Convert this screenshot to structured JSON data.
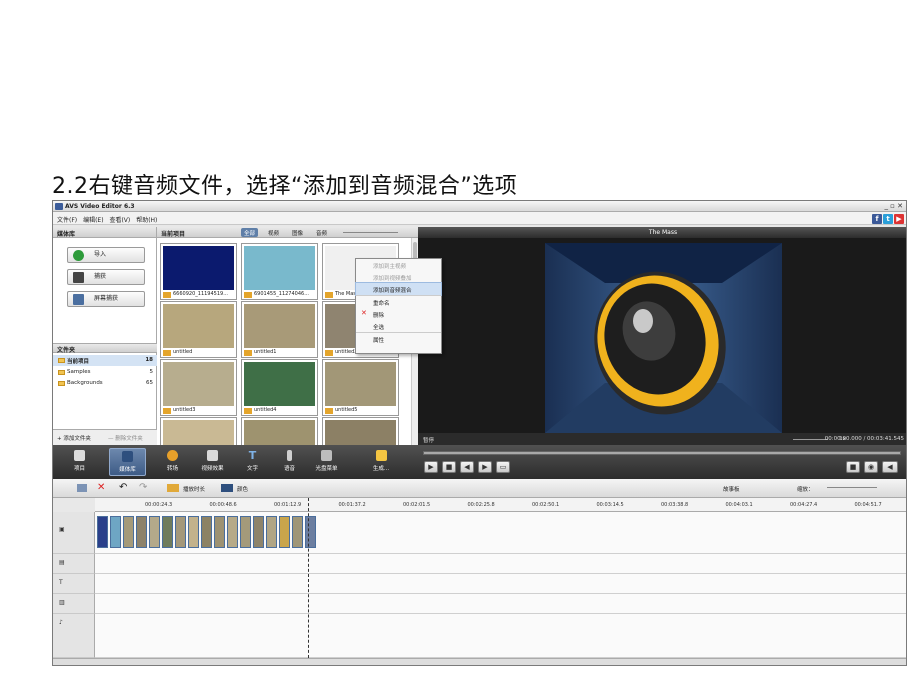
{
  "heading": "2.2右键音频文件，选择“添加到音频混合”选项",
  "window": {
    "title": "AVS Video Editor 6.3",
    "controls": "_ ▫ ✕"
  },
  "menu": [
    "文件(F)",
    "编辑(E)",
    "查看(V)",
    "帮助(H)"
  ],
  "social": [
    {
      "icon": "facebook-icon",
      "label": "f",
      "color": "#3b5998"
    },
    {
      "icon": "twitter-icon",
      "label": "t",
      "color": "#2b9fd9"
    },
    {
      "icon": "youtube-icon",
      "label": "▶",
      "color": "#d33"
    }
  ],
  "library": {
    "title": "媒体库",
    "buttons": [
      "导入",
      "捕获",
      "屏幕捕获"
    ],
    "folders_title": "文件夹",
    "folders": [
      {
        "name": "当前项目",
        "count": "18"
      },
      {
        "name": "Samples",
        "count": "5"
      },
      {
        "name": "Backgrounds",
        "count": "65"
      }
    ],
    "add_folder": "+ 添加文件夹",
    "remove_folder": "— 删除文件夹"
  },
  "media": {
    "current": "当前项目",
    "filters": [
      "全部",
      "视频",
      "图像",
      "音频"
    ],
    "thumbs": [
      {
        "label": "6660920_11194519...",
        "fill": "#0b1a6e"
      },
      {
        "label": "6901455_11274046...",
        "fill": "#79b9cc"
      },
      {
        "label": "The Mass",
        "fill": "#f0f0f0"
      },
      {
        "label": "untitled",
        "fill": "#b7a77d"
      },
      {
        "label": "untitled1",
        "fill": "#a89a78"
      },
      {
        "label": "untitled2",
        "fill": "#8f8470"
      },
      {
        "label": "untitled3",
        "fill": "#b7ad8e"
      },
      {
        "label": "untitled4",
        "fill": "#3f6f47"
      },
      {
        "label": "untitled5",
        "fill": "#a29777"
      },
      {
        "label": "",
        "fill": "#c9b994"
      },
      {
        "label": "",
        "fill": "#9e936f"
      },
      {
        "label": "",
        "fill": "#8c8065"
      }
    ]
  },
  "context_menu": [
    {
      "label": "添加到主视频",
      "state": "disabled"
    },
    {
      "label": "添加到视频叠加",
      "state": "disabled"
    },
    {
      "label": "添加到音频混合",
      "state": "highlight"
    },
    {
      "label": "重命名",
      "state": "normal"
    },
    {
      "label": "删除",
      "state": "delete"
    },
    {
      "label": "全选",
      "state": "normal"
    },
    {
      "label": "属性",
      "state": "normal"
    }
  ],
  "preview": {
    "title": "The Mass",
    "status": "暂停",
    "speed": "1x",
    "time": "00:00:00.000 / 00:03:41.545"
  },
  "toolbar": [
    "项目",
    "媒体库",
    "转场",
    "视频效果",
    "文字",
    "语音",
    "光盘菜单",
    "生成..."
  ],
  "timeline": {
    "tools": [
      "撤销",
      "重做"
    ],
    "duration_label": "播放时长",
    "color_label": "颜色",
    "storyboard": "故事板",
    "zoom": "缩放：",
    "ruler": [
      "00:00:24.3",
      "00:00:48.6",
      "00:01:12.9",
      "00:01:37.2",
      "00:02:01.5",
      "00:02:25.8",
      "00:02:50.1",
      "00:03:14.5",
      "00:03:38.8",
      "00:04:03.1",
      "00:04:27.4",
      "00:04:51.7"
    ],
    "track_icons": [
      "video-track-icon",
      "overlay-track-icon",
      "text-track-icon",
      "voice-track-icon",
      "music-track-icon"
    ],
    "clip_count": 17,
    "track_labels": [
      "▣",
      "▤",
      "T",
      "▥",
      "♪"
    ]
  }
}
